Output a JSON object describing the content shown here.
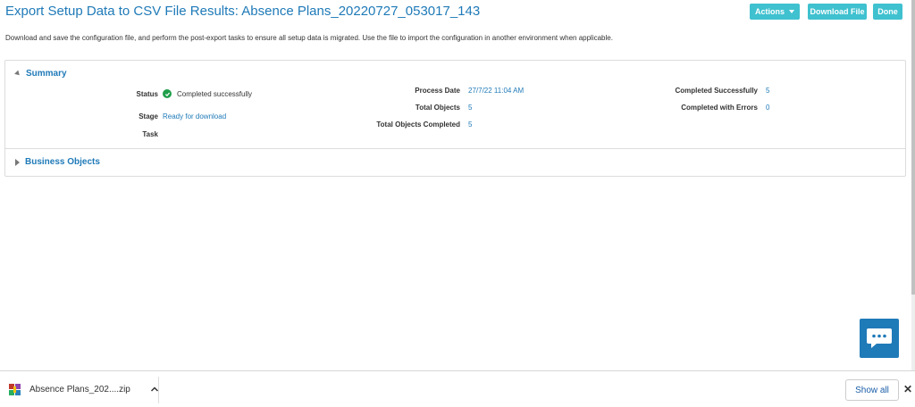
{
  "header": {
    "title": "Export Setup Data to CSV File Results: Absence Plans_20220727_053017_143",
    "actions_label": "Actions",
    "download_label": "Download File",
    "done_label": "Done"
  },
  "description": "Download and save the configuration file, and perform the post-export tasks to ensure all setup data is migrated. Use the file to import the configuration in another environment when applicable.",
  "summary": {
    "heading": "Summary",
    "status_label": "Status",
    "status_value": "Completed successfully",
    "stage_label": "Stage",
    "stage_value": "Ready for download",
    "task_label": "Task",
    "process_date_label": "Process Date",
    "process_date_value": "27/7/22 11:04 AM",
    "total_objects_label": "Total Objects",
    "total_objects_value": "5",
    "total_completed_label": "Total Objects Completed",
    "total_completed_value": "5",
    "completed_success_label": "Completed Successfully",
    "completed_success_value": "5",
    "completed_errors_label": "Completed with Errors",
    "completed_errors_value": "0"
  },
  "business_objects": {
    "heading": "Business Objects"
  },
  "download_bar": {
    "file_name": "Absence Plans_202....zip",
    "show_all_label": "Show all"
  },
  "colors": {
    "accent": "#1f7ab8",
    "button": "#3fc1cf",
    "success": "#1f9e4a"
  }
}
